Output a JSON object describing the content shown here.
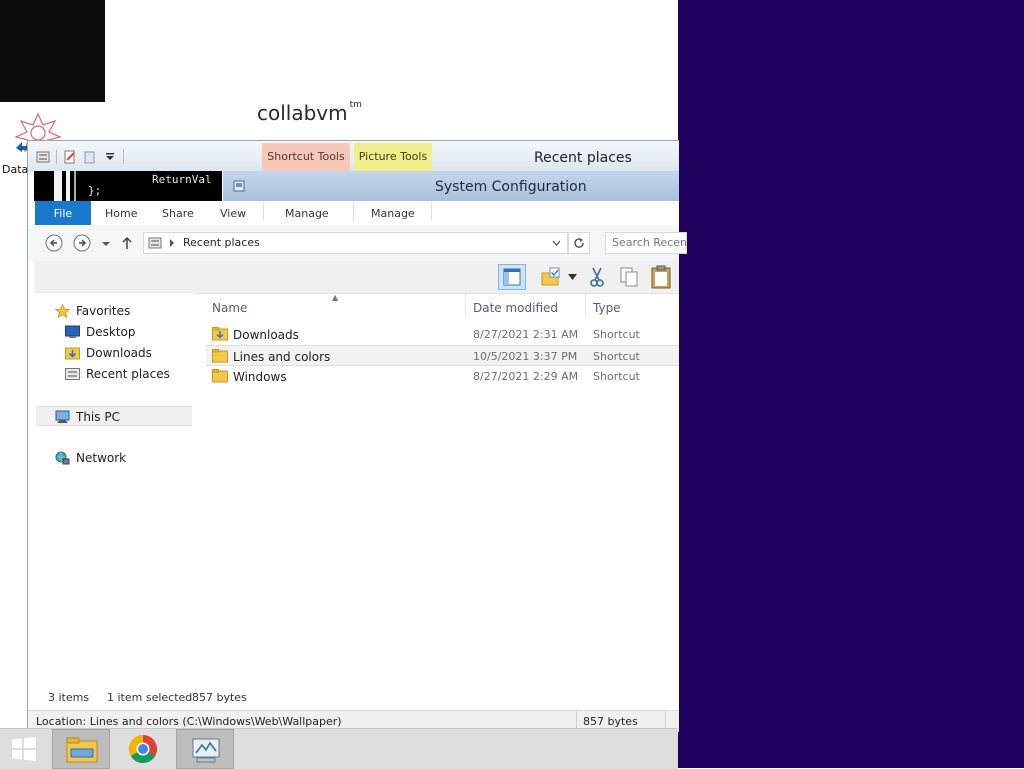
{
  "desktop": {
    "logo_text": "collabvm",
    "logo_mark": "tm",
    "icon_label": "Data"
  },
  "window": {
    "title": "Recent places",
    "context_tabs": {
      "shortcut_tools": "Shortcut Tools",
      "picture_tools": "Picture Tools"
    },
    "overlay_title": "System Configuration",
    "console_text": [
      "ReturnVal",
      "};"
    ]
  },
  "ribbon": {
    "tabs": [
      "File",
      "Home",
      "Share",
      "View",
      "Manage",
      "Manage"
    ]
  },
  "address": {
    "path": "Recent places",
    "search_placeholder": "Search Recent places"
  },
  "navigation": {
    "favorites": "Favorites",
    "desktop": "Desktop",
    "downloads": "Downloads",
    "recent_places": "Recent places",
    "this_pc": "This PC",
    "network": "Network"
  },
  "columns": {
    "name": "Name",
    "date_modified": "Date modified",
    "type": "Type"
  },
  "files": [
    {
      "name": "Downloads",
      "date": "8/27/2021 2:31 AM",
      "type": "Shortcut"
    },
    {
      "name": "Lines and colors",
      "date": "10/5/2021 3:37 PM",
      "type": "Shortcut"
    },
    {
      "name": "Windows",
      "date": "8/27/2021 2:29 AM",
      "type": "Shortcut"
    }
  ],
  "status": {
    "items": "3 items",
    "selected": "1 item selected",
    "size": "857 bytes"
  },
  "details": {
    "location": "Location: Lines and colors (C:\\Windows\\Web\\Wallpaper)",
    "size": "857 bytes"
  },
  "colors": {
    "desktop_right": "#20005e",
    "file_tab": "#1979ca",
    "shortcut_tools": "#f8c8b6",
    "picture_tools": "#f1ef8b"
  }
}
